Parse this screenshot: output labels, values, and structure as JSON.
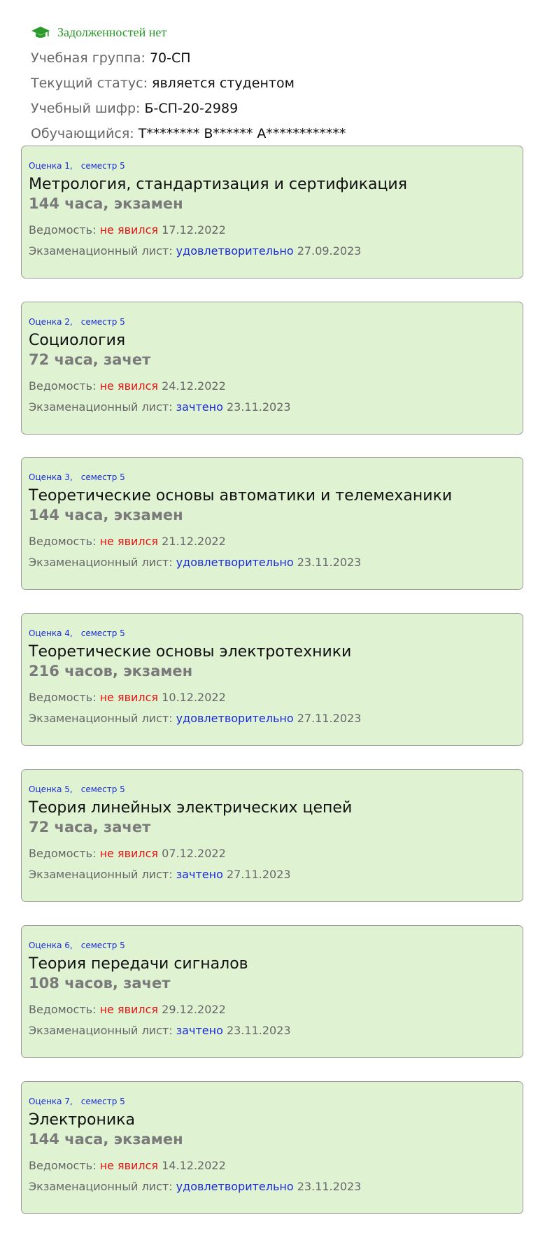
{
  "header": {
    "debt_status": "Задолженностей нет",
    "debt_icon": "graduation-cap-icon",
    "fields": [
      {
        "label": "Учебная группа:",
        "value": "70-СП"
      },
      {
        "label": "Текущий статус:",
        "value": "является студентом"
      },
      {
        "label": "Учебный шифр:",
        "value": "Б-СП-20-2989"
      },
      {
        "label": "Обучающийся:",
        "value": "Т******** В****** А************"
      }
    ]
  },
  "colors": {
    "card_bg": "#dff3d3",
    "accent_green": "#2a9a2a",
    "failed_red": "#e01515",
    "link_blue": "#1a2ad6"
  },
  "grades": [
    {
      "label": "Оценка 1,",
      "semester": "семестр 5",
      "subject": "Метрология, стандартизация и сертификация",
      "hours": "144 часа, экзамен",
      "sheet_label": "Ведомость:",
      "sheet_result": "не явился",
      "sheet_date": "17.12.2022",
      "exam_label": "Экзаменационный лист:",
      "exam_result": "удовлетворительно",
      "exam_date": "27.09.2023"
    },
    {
      "label": "Оценка 2,",
      "semester": "семестр 5",
      "subject": "Социология",
      "hours": "72 часа, зачет",
      "sheet_label": "Ведомость:",
      "sheet_result": "не явился",
      "sheet_date": "24.12.2022",
      "exam_label": "Экзаменационный лист:",
      "exam_result": "зачтено",
      "exam_date": "23.11.2023"
    },
    {
      "label": "Оценка 3,",
      "semester": "семестр 5",
      "subject": "Теоретические основы автоматики и телемеханики",
      "hours": "144 часа, экзамен",
      "sheet_label": "Ведомость:",
      "sheet_result": "не явился",
      "sheet_date": "21.12.2022",
      "exam_label": "Экзаменационный лист:",
      "exam_result": "удовлетворительно",
      "exam_date": "23.11.2023"
    },
    {
      "label": "Оценка 4,",
      "semester": "семестр 5",
      "subject": "Теоретические основы электротехники",
      "hours": "216 часов, экзамен",
      "sheet_label": "Ведомость:",
      "sheet_result": "не явился",
      "sheet_date": "10.12.2022",
      "exam_label": "Экзаменационный лист:",
      "exam_result": "удовлетворительно",
      "exam_date": "27.11.2023"
    },
    {
      "label": "Оценка 5,",
      "semester": "семестр 5",
      "subject": "Теория линейных электрических цепей",
      "hours": "72 часа, зачет",
      "sheet_label": "Ведомость:",
      "sheet_result": "не явился",
      "sheet_date": "07.12.2022",
      "exam_label": "Экзаменационный лист:",
      "exam_result": "зачтено",
      "exam_date": "27.11.2023"
    },
    {
      "label": "Оценка 6,",
      "semester": "семестр 5",
      "subject": "Теория передачи сигналов",
      "hours": "108 часов, зачет",
      "sheet_label": "Ведомость:",
      "sheet_result": "не явился",
      "sheet_date": "29.12.2022",
      "exam_label": "Экзаменационный лист:",
      "exam_result": "зачтено",
      "exam_date": "23.11.2023"
    },
    {
      "label": "Оценка 7,",
      "semester": "семестр 5",
      "subject": "Электроника",
      "hours": "144 часа, экзамен",
      "sheet_label": "Ведомость:",
      "sheet_result": "не явился",
      "sheet_date": "14.12.2022",
      "exam_label": "Экзаменационный лист:",
      "exam_result": "удовлетворительно",
      "exam_date": "23.11.2023"
    }
  ]
}
